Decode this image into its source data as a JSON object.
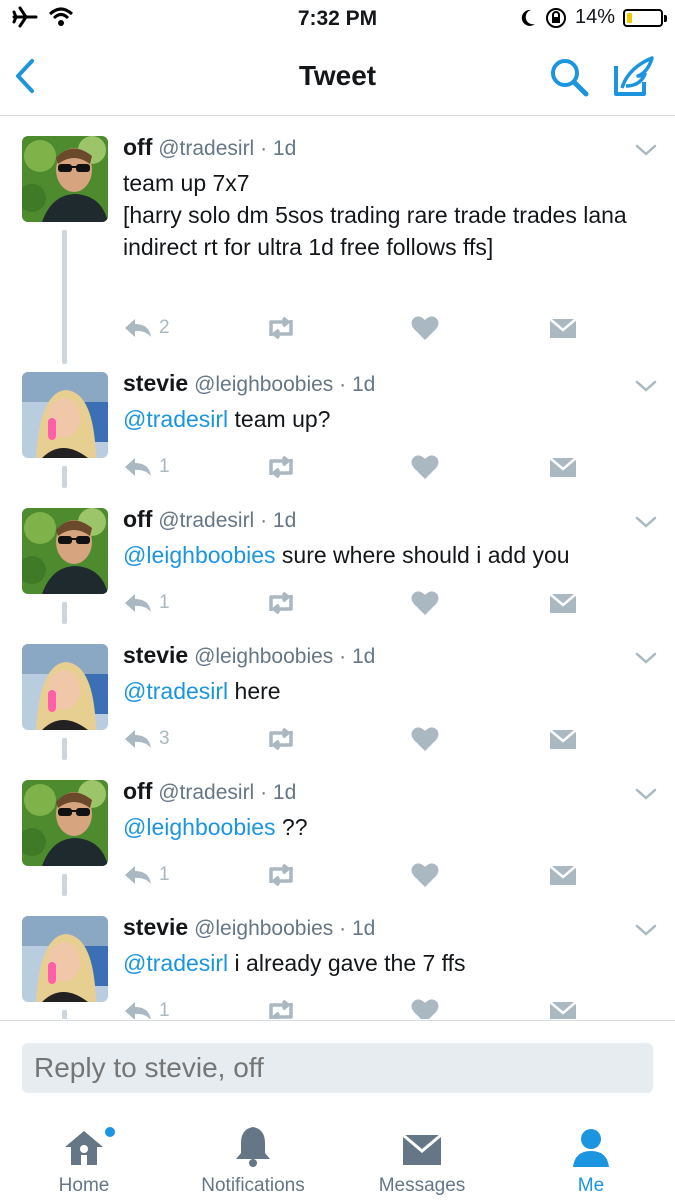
{
  "status_bar": {
    "time": "7:32 PM",
    "battery": "14%"
  },
  "nav": {
    "title": "Tweet"
  },
  "tweets": [
    {
      "name": "off",
      "handle": "@tradesirl",
      "time": "· 1d",
      "mention": "",
      "text": "team up 7x7\n[harry solo dm 5sos trading rare trade trades lana indirect rt for ultra 1d free follows ffs]",
      "replies": "2"
    },
    {
      "name": "stevie",
      "handle": "@leighboobies",
      "time": "· 1d",
      "mention": "@tradesirl",
      "text": " team up?",
      "replies": "1"
    },
    {
      "name": "off",
      "handle": "@tradesirl",
      "time": "· 1d",
      "mention": "@leighboobies",
      "text": " sure where should i add you",
      "replies": "1"
    },
    {
      "name": "stevie",
      "handle": "@leighboobies",
      "time": "· 1d",
      "mention": "@tradesirl",
      "text": " here",
      "replies": "3"
    },
    {
      "name": "off",
      "handle": "@tradesirl",
      "time": "· 1d",
      "mention": "@leighboobies",
      "text": " ??",
      "replies": "1"
    },
    {
      "name": "stevie",
      "handle": "@leighboobies",
      "time": "· 1d",
      "mention": "@tradesirl",
      "text": " i already gave the 7 ffs",
      "replies": "1"
    }
  ],
  "reply": {
    "placeholder": "Reply to stevie, off"
  },
  "tabs": [
    {
      "label": "Home",
      "icon": "home-icon"
    },
    {
      "label": "Notifications",
      "icon": "bell-icon"
    },
    {
      "label": "Messages",
      "icon": "envelope-icon"
    },
    {
      "label": "Me",
      "icon": "person-icon"
    }
  ],
  "colors": {
    "accent": "#1b95e0",
    "muted": "#aab8c2",
    "text": "#14171a",
    "secondary": "#657786"
  }
}
